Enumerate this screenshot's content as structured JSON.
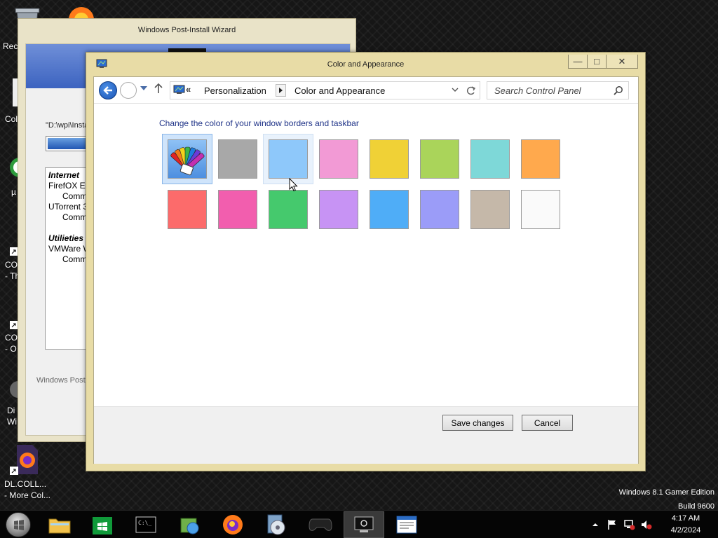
{
  "desktop": {
    "icons": [
      {
        "label": "Rec"
      },
      {
        "label": "Col"
      },
      {
        "label": "µ"
      },
      {
        "label": "CO\n- Th"
      },
      {
        "label": "CO\n- O"
      },
      {
        "label": "Di\nWi"
      },
      {
        "label": "DL.COLL...\n- More Col..."
      }
    ],
    "watermark": {
      "line1": "Windows 8.1 Gamer Edition",
      "line2": "Build 9600"
    }
  },
  "wizard": {
    "title": "Windows Post-Install Wizard",
    "path_text": "\"D:\\wpi\\Insta",
    "progress": 0.9,
    "list": [
      {
        "type": "cat",
        "text": "Internet"
      },
      {
        "type": "item",
        "text": "FirefOX E"
      },
      {
        "type": "sub",
        "text": "Comm"
      },
      {
        "type": "item",
        "text": "UTorrent 3"
      },
      {
        "type": "sub",
        "text": "Comm"
      },
      {
        "type": "cat",
        "text": "Utilieties"
      },
      {
        "type": "item",
        "text": "VMWare W"
      },
      {
        "type": "sub",
        "text": "Comm"
      }
    ],
    "footer_text": "Windows Post"
  },
  "window": {
    "title": "Color and Appearance",
    "controls": {
      "minimize": "—",
      "maximize": "□",
      "close": "✕"
    }
  },
  "address_bar": {
    "chevron": "«",
    "breadcrumbs": [
      "Personalization",
      "Color and Appearance"
    ]
  },
  "search": {
    "placeholder": "Search Control Panel"
  },
  "content": {
    "heading": "Change the color of your window borders and taskbar",
    "swatches": [
      {
        "name": "automatic",
        "color": "auto",
        "state": "selected"
      },
      {
        "name": "gray",
        "color": "#a8a8a8",
        "state": ""
      },
      {
        "name": "light-blue",
        "color": "#8ec8fa",
        "state": "hover"
      },
      {
        "name": "pink",
        "color": "#f29ad5",
        "state": ""
      },
      {
        "name": "yellow",
        "color": "#f0d136",
        "state": ""
      },
      {
        "name": "lime",
        "color": "#aad45a",
        "state": ""
      },
      {
        "name": "teal",
        "color": "#7ed8d8",
        "state": ""
      },
      {
        "name": "orange",
        "color": "#ffa94d",
        "state": ""
      },
      {
        "name": "red",
        "color": "#fc6b6b",
        "state": ""
      },
      {
        "name": "magenta",
        "color": "#f25eae",
        "state": ""
      },
      {
        "name": "green",
        "color": "#45c96d",
        "state": ""
      },
      {
        "name": "purple",
        "color": "#c793f4",
        "state": ""
      },
      {
        "name": "blue",
        "color": "#4fadf7",
        "state": ""
      },
      {
        "name": "periwinkle",
        "color": "#9b9cf8",
        "state": ""
      },
      {
        "name": "taupe",
        "color": "#c5b8a9",
        "state": ""
      },
      {
        "name": "white",
        "color": "#fafafa",
        "state": ""
      }
    ]
  },
  "buttons": {
    "save": "Save changes",
    "cancel": "Cancel"
  },
  "taskbar": {
    "items": [
      {
        "name": "file-explorer-icon",
        "active": false
      },
      {
        "name": "store-icon",
        "active": false
      },
      {
        "name": "command-prompt-icon",
        "active": false
      },
      {
        "name": "installer-icon",
        "active": false
      },
      {
        "name": "firefox-icon",
        "active": false
      },
      {
        "name": "disc-tool-icon",
        "active": false
      },
      {
        "name": "gamepad-icon",
        "active": false
      },
      {
        "name": "control-panel-icon",
        "active": true
      },
      {
        "name": "document-icon",
        "active": false
      }
    ],
    "clock": {
      "time": "4:17 AM",
      "date": "4/2/2024"
    }
  }
}
